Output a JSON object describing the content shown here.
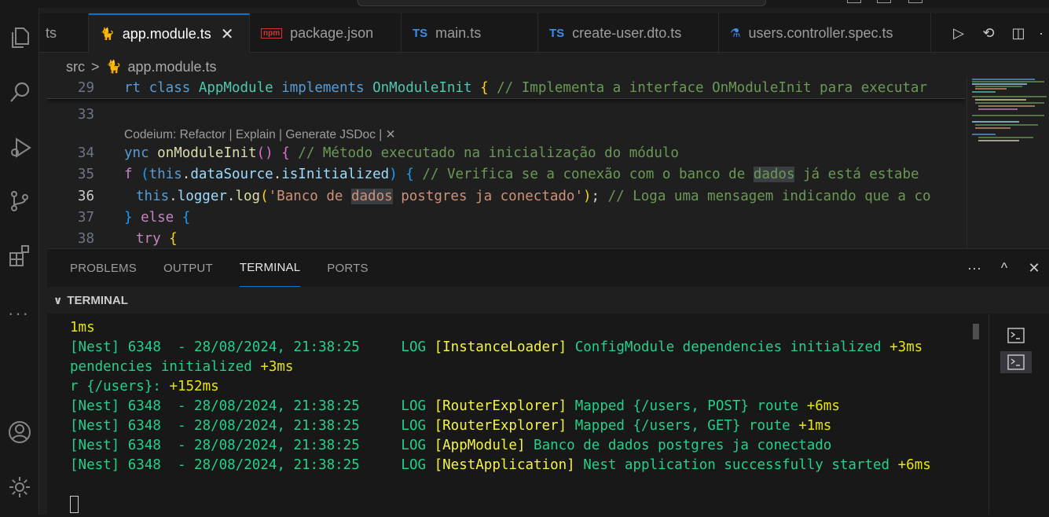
{
  "tabs": [
    {
      "label": "ts",
      "icon": "typescript-icon",
      "active": false,
      "partial": true
    },
    {
      "label": "app.module.ts",
      "icon": "nest-icon",
      "active": true,
      "close": "✕"
    },
    {
      "label": "package.json",
      "icon": "npm-icon",
      "active": false
    },
    {
      "label": "main.ts",
      "icon": "TS",
      "active": false
    },
    {
      "label": "create-user.dto.ts",
      "icon": "TS",
      "active": false
    },
    {
      "label": "users.controller.spec.ts",
      "icon": "flask-icon",
      "active": false
    }
  ],
  "breadcrumb": {
    "folder": "src",
    "separator": ">",
    "file": "app.module.ts"
  },
  "editor": {
    "codelens": "Codeium: Refactor | Explain | Generate JSDoc | ✕",
    "lines": [
      {
        "num": "29",
        "sticky": true
      },
      {
        "num": "33"
      },
      {
        "num": "34"
      },
      {
        "num": "35"
      },
      {
        "num": "36",
        "current": true
      },
      {
        "num": "37"
      },
      {
        "num": "38"
      }
    ],
    "code": {
      "l29_a": "rt ",
      "l29_b": "class ",
      "l29_c": "AppModule ",
      "l29_d": "implements ",
      "l29_e": "OnModuleInit ",
      "l29_f": "{ ",
      "l29_g": "// Implementa a interface OnModuleInit para executar",
      "l34_a": "ync ",
      "l34_b": "onModuleInit",
      "l34_c": "() ",
      "l34_d": "{ ",
      "l34_e": "// Método executado na inicialização do módulo",
      "l35_a": "f ",
      "l35_b": "(",
      "l35_c": "this",
      "l35_d": ".",
      "l35_e": "dataSource",
      "l35_f": ".",
      "l35_g": "isInitialized",
      "l35_h": ") ",
      "l35_i": "{ ",
      "l35_j": "// Verifica se a conexão com o banco de ",
      "l35_k": "dados",
      "l35_l": " já está estabe",
      "l36_a": "this",
      "l36_b": ".",
      "l36_c": "logger",
      "l36_d": ".",
      "l36_e": "log",
      "l36_f": "(",
      "l36_g": "'Banco de ",
      "l36_h": "dados",
      "l36_i": " postgres ja conectado'",
      "l36_j": ")",
      "l36_k": "; ",
      "l36_l": "// Loga uma mensagem indicando que a co",
      "l37_a": "} ",
      "l37_b": "else ",
      "l37_c": "{",
      "l38_a": "try ",
      "l38_b": "{"
    }
  },
  "panel": {
    "tabs": [
      "PROBLEMS",
      "OUTPUT",
      "TERMINAL",
      "PORTS"
    ],
    "active_tab": "TERMINAL",
    "actions": [
      "···",
      "^",
      "✕"
    ],
    "section_title": "TERMINAL"
  },
  "terminal": {
    "lines": [
      {
        "kind": "plain",
        "text": "1ms"
      },
      {
        "kind": "log",
        "prefix": "[Nest] 6348  - 28/08/2024, 21:38:25     LOG ",
        "ctx": "[InstanceLoader]",
        "msg": " ConfigModule dependencies initialized ",
        "ms": "+3ms"
      },
      {
        "kind": "wrap",
        "msg": "pendencies initialized ",
        "ms": "+3ms"
      },
      {
        "kind": "wrap",
        "msg": "r {/users}: ",
        "ms": "+152ms"
      },
      {
        "kind": "log",
        "prefix": "[Nest] 6348  - 28/08/2024, 21:38:25     LOG ",
        "ctx": "[RouterExplorer]",
        "msg": " Mapped {/users, POST} route ",
        "ms": "+6ms"
      },
      {
        "kind": "log",
        "prefix": "[Nest] 6348  - 28/08/2024, 21:38:25     LOG ",
        "ctx": "[RouterExplorer]",
        "msg": " Mapped {/users, GET} route ",
        "ms": "+1ms"
      },
      {
        "kind": "log",
        "prefix": "[Nest] 6348  - 28/08/2024, 21:38:25     LOG ",
        "ctx": "[AppModule]",
        "msg": " Banco de dados postgres ja conectado",
        "ms": ""
      },
      {
        "kind": "log",
        "prefix": "[Nest] 6348  - 28/08/2024, 21:38:25     LOG ",
        "ctx": "[NestApplication]",
        "msg": " Nest application successfully started ",
        "ms": "+6ms"
      }
    ]
  },
  "colors": {
    "accent": "#0078d4",
    "terminal_green": "#23d18b",
    "terminal_yellow": "#f5f543"
  }
}
